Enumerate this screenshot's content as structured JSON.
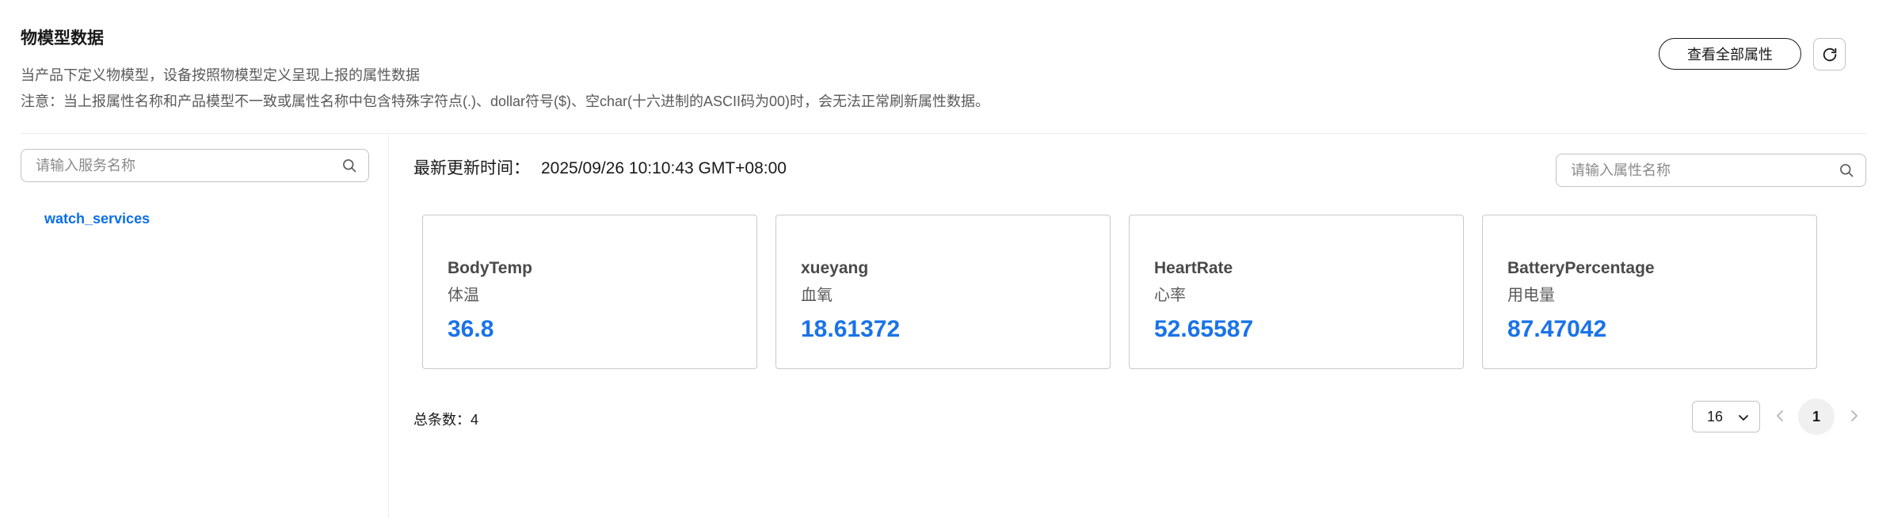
{
  "header": {
    "title": "物模型数据",
    "description": "当产品下定义物模型，设备按照物模型定义呈现上报的属性数据",
    "notice": "注意：当上报属性名称和产品模型不一致或属性名称中包含特殊字符点(.)、dollar符号($)、空char(十六进制的ASCII码为00)时，会无法正常刷新属性数据。",
    "view_all_label": "查看全部属性",
    "refresh_icon": "refresh-icon"
  },
  "sidebar": {
    "search_placeholder": "请输入服务名称",
    "services": [
      {
        "label": "watch_services",
        "selected": true
      }
    ]
  },
  "main": {
    "update_label": "最新更新时间：",
    "update_time": "2025/09/26 10:10:43 GMT+08:00",
    "search_placeholder": "请输入属性名称",
    "properties": [
      {
        "name": "BodyTemp",
        "chinese_name": "体温",
        "value": "36.8"
      },
      {
        "name": "xueyang",
        "chinese_name": "血氧",
        "value": "18.61372"
      },
      {
        "name": "HeartRate",
        "chinese_name": "心率",
        "value": "52.65587"
      },
      {
        "name": "BatteryPercentage",
        "chinese_name": "用电量",
        "value": "87.47042"
      }
    ]
  },
  "pagination": {
    "total_label": "总条数：4",
    "page_size": "16",
    "current_page": "1"
  },
  "colors": {
    "accent": "#1a73e8",
    "link": "#0b6fe8",
    "border": "#c9c9c9"
  }
}
